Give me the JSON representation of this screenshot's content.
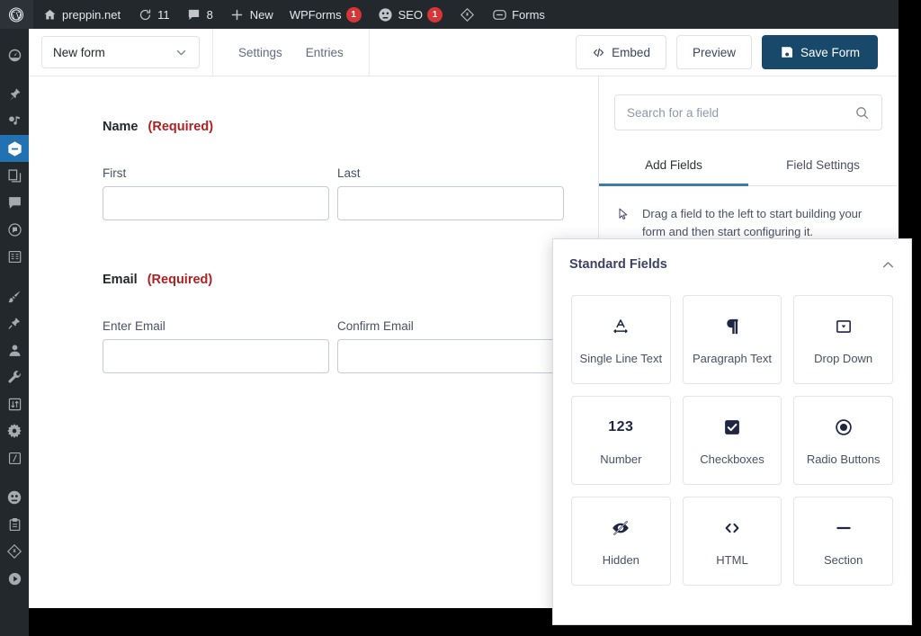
{
  "adminbar": {
    "logo_icon": "wordpress-logo-icon",
    "items": [
      {
        "icon": "home-icon",
        "label": "preppin.net",
        "badge": null
      },
      {
        "icon": "updates-icon",
        "label": "11",
        "badge": null
      },
      {
        "icon": "comment-icon",
        "label": "8",
        "badge": null
      },
      {
        "icon": "plus-icon",
        "label": "New",
        "badge": null
      },
      {
        "icon": null,
        "label": "WPForms",
        "badge": "1"
      },
      {
        "icon": "seo-icon",
        "label": "SEO",
        "badge": "1"
      },
      {
        "icon": "diamond-icon",
        "label": "",
        "badge": null
      },
      {
        "icon": "forms-icon",
        "label": "Forms",
        "badge": null
      }
    ]
  },
  "adminmenu": {
    "items": [
      {
        "name": "dashboard",
        "icon": "gauge-icon",
        "active": false
      },
      {
        "name": "posts",
        "icon": "pin-icon",
        "active": false
      },
      {
        "name": "media",
        "icon": "media-icon",
        "active": false
      },
      {
        "name": "wpforms",
        "icon": "wpforms-icon",
        "active": true
      },
      {
        "name": "pages",
        "icon": "pages-icon",
        "active": false
      },
      {
        "name": "comments",
        "icon": "comment-icon",
        "active": false
      },
      {
        "name": "feedback",
        "icon": "feedback-icon",
        "active": false
      },
      {
        "name": "forms",
        "icon": "list-icon",
        "active": false
      },
      {
        "name": "appearance",
        "icon": "brush-icon",
        "active": false
      },
      {
        "name": "plugins",
        "icon": "plug-icon",
        "active": false
      },
      {
        "name": "users",
        "icon": "user-icon",
        "active": false
      },
      {
        "name": "tools",
        "icon": "wrench-icon",
        "active": false
      },
      {
        "name": "import",
        "icon": "transfer-icon",
        "active": false
      },
      {
        "name": "settings",
        "icon": "gear-icon",
        "active": false
      },
      {
        "name": "code",
        "icon": "code-icon",
        "active": false
      },
      {
        "name": "seo",
        "icon": "seo-icon",
        "active": false
      },
      {
        "name": "clipboard",
        "icon": "clipboard-icon",
        "active": false
      },
      {
        "name": "elementor",
        "icon": "diamond-icon",
        "active": false
      },
      {
        "name": "player",
        "icon": "play-icon",
        "active": false
      }
    ]
  },
  "toolbar": {
    "form_name": "New form",
    "settings_label": "Settings",
    "entries_label": "Entries",
    "embed_label": "Embed",
    "preview_label": "Preview",
    "save_label": "Save Form"
  },
  "canvas": {
    "fields": [
      {
        "label": "Name",
        "required_text": "(Required)",
        "sublabels": [
          "First",
          "Last"
        ],
        "values": [
          "",
          ""
        ]
      },
      {
        "label": "Email",
        "required_text": "(Required)",
        "sublabels": [
          "Enter Email",
          "Confirm Email"
        ],
        "values": [
          "",
          ""
        ]
      }
    ]
  },
  "sidebar": {
    "search_placeholder": "Search for a field",
    "search_value": "",
    "tabs": [
      {
        "label": "Add Fields",
        "active": true
      },
      {
        "label": "Field Settings",
        "active": false
      }
    ],
    "hint": "Drag a field to the left to start building your form and then start configuring it."
  },
  "standard_fields": {
    "title": "Standard Fields",
    "collapsed": false,
    "collapse_icon": "chevron-up-icon",
    "cards": [
      {
        "label": "Single Line Text",
        "icon": "single-line-text-icon"
      },
      {
        "label": "Paragraph Text",
        "icon": "paragraph-icon"
      },
      {
        "label": "Drop Down",
        "icon": "dropdown-icon"
      },
      {
        "label": "Number",
        "icon": "number-123-icon"
      },
      {
        "label": "Checkboxes",
        "icon": "checkbox-icon"
      },
      {
        "label": "Radio Buttons",
        "icon": "radio-icon"
      },
      {
        "label": "Hidden",
        "icon": "eye-slash-icon"
      },
      {
        "label": "HTML",
        "icon": "code-brackets-icon"
      },
      {
        "label": "Section",
        "icon": "minus-icon"
      }
    ]
  },
  "colors": {
    "admin_bar": "#23282d",
    "active_menu": "#2271b1",
    "primary_button": "#18496b",
    "badge_red": "#d63638",
    "required_red": "#b02020",
    "tab_underline": "#3c7ca8"
  }
}
